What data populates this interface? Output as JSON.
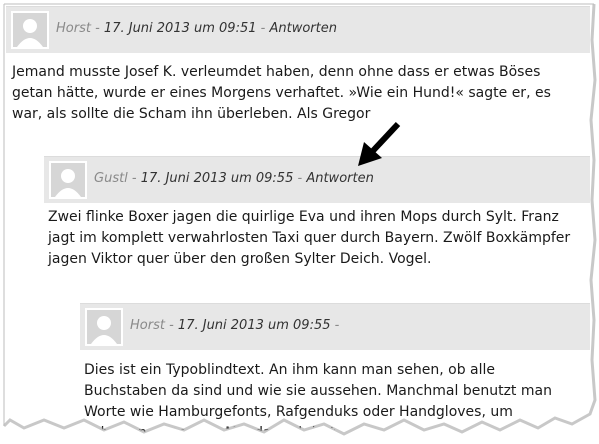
{
  "comments": [
    {
      "author": "Horst",
      "separator": " - ",
      "date": "17. Juni 2013 um 09:51",
      "separator2": " - ",
      "reply": "Antworten",
      "text": "Jemand musste Josef K. verleumdet haben, denn ohne dass er etwas Böses getan hätte, wurde er eines Morgens verhaftet. »Wie ein Hund!« sagte er, es war, als sollte die Scham ihn überleben. Als Gregor"
    },
    {
      "author": "Gustl",
      "separator": " - ",
      "date": "17. Juni 2013 um 09:55",
      "separator2": " - ",
      "reply": "Antworten",
      "text": "Zwei flinke Boxer jagen die quirlige Eva und ihren Mops durch Sylt. Franz jagt im komplett verwahrlosten Taxi quer durch Bayern. Zwölf Boxkämpfer jagen Viktor quer über den großen Sylter Deich. Vogel."
    },
    {
      "author": "Horst",
      "separator": " - ",
      "date": "17. Juni 2013 um 09:55",
      "separator2": " -",
      "reply": "",
      "text": "Dies ist ein Typoblindtext. An ihm kann man sehen, ob alle Buchstaben da sind und wie sie aussehen. Manchmal benutzt man Worte wie Hamburgefonts, Rafgenduks oder Handgloves, um Schriften zu testen. Mal da mal dort"
    }
  ],
  "icons": {
    "avatar": "avatar-placeholder-icon",
    "annotation": "arrow-pointer-icon"
  },
  "colors": {
    "header_bg": "#e7e7e7",
    "avatar_bg": "#d6d6d6",
    "text": "#1a1a1a",
    "muted": "#8a8a8a"
  }
}
